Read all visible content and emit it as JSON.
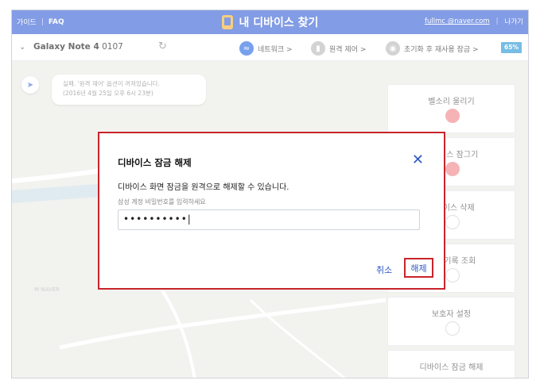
{
  "header": {
    "guide": "가이드",
    "faq": "FAQ",
    "title": "내 디바이스 찾기",
    "email": "fullmc        @naver.com",
    "logout": "나가기"
  },
  "device": {
    "name": "Galaxy Note 4",
    "number": "0107",
    "network": "네트워크 >",
    "remote": "원격 제어 >",
    "reactivation": "초기화 후 재사용 잠금 >",
    "battery": "65%"
  },
  "map": {
    "bubble_line1": "실패. '원격 제어' 옵션이 꺼져있습니다.",
    "bubble_line2": "(2016년 4월 25일 오후 6시 23분)",
    "logo": "M NAVER"
  },
  "actions": [
    {
      "label": "벨소리 울리기"
    },
    {
      "label": "디바이스 잠그기"
    },
    {
      "label": "디바이스 삭제"
    },
    {
      "label": "통화 기록 조회"
    },
    {
      "label": "보호자 설정"
    },
    {
      "label": "디바이스 잠금 해제"
    }
  ],
  "dialog": {
    "title": "디바이스 잠금 해제",
    "description": "디바이스 화면 잠금을 원격으로 해제할 수 있습니다.",
    "hint": "삼성 계정 비밀번호를 입력하세요",
    "password": "••••••••••|",
    "cancel": "취소",
    "confirm": "해제"
  },
  "colors": {
    "brand_blue": "#3f67d8",
    "highlight_red": "#c8242b"
  }
}
